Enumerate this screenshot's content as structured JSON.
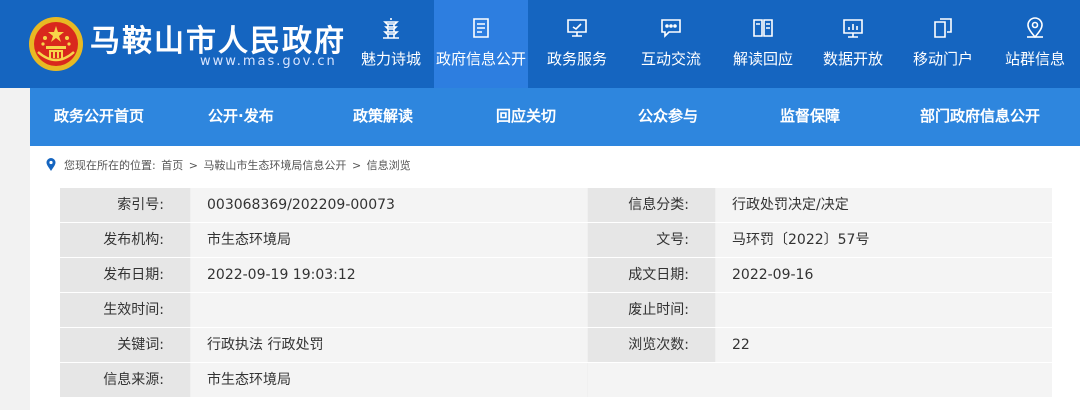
{
  "site": {
    "title": "马鞍山市人民政府",
    "url": "www.mas.gov.cn",
    "brand_color": "#1565c0",
    "accent_color": "#2e86de"
  },
  "topnav": [
    {
      "label": "魅力诗城",
      "icon": "pagoda-icon"
    },
    {
      "label": "政府信息公开",
      "icon": "document-icon",
      "active": true
    },
    {
      "label": "政务服务",
      "icon": "monitor-icon"
    },
    {
      "label": "互动交流",
      "icon": "chat-icon"
    },
    {
      "label": "解读回应",
      "icon": "book-icon"
    },
    {
      "label": "数据开放",
      "icon": "chart-icon"
    },
    {
      "label": "移动门户",
      "icon": "mobile-icon"
    },
    {
      "label": "站群信息",
      "icon": "location-icon"
    }
  ],
  "subnav": [
    "政务公开首页",
    "公开·发布",
    "政策解读",
    "回应关切",
    "公众参与",
    "监督保障",
    "部门政府信息公开"
  ],
  "breadcrumb": {
    "prefix": "您现在所在的位置:",
    "items": [
      "首页",
      "马鞍山市生态环境局信息公开",
      "信息浏览"
    ],
    "separator": ">"
  },
  "info": [
    [
      {
        "label": "索引号:",
        "value": "003068369/202209-00073"
      },
      {
        "label": "信息分类:",
        "value": "行政处罚决定/决定"
      }
    ],
    [
      {
        "label": "发布机构:",
        "value": "市生态环境局"
      },
      {
        "label": "文号:",
        "value": "马环罚〔2022〕57号"
      }
    ],
    [
      {
        "label": "发布日期:",
        "value": "2022-09-19 19:03:12"
      },
      {
        "label": "成文日期:",
        "value": "2022-09-16"
      }
    ],
    [
      {
        "label": "生效时间:",
        "value": ""
      },
      {
        "label": "废止时间:",
        "value": ""
      }
    ],
    [
      {
        "label": "关键词:",
        "value": "行政执法 行政处罚"
      },
      {
        "label": "浏览次数:",
        "value": "22"
      }
    ],
    [
      {
        "label": "信息来源:",
        "value": "市生态环境局"
      },
      {
        "label": "",
        "value": ""
      }
    ]
  ]
}
